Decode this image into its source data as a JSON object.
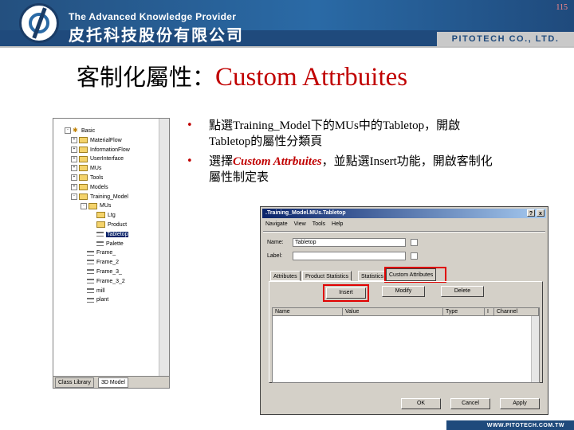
{
  "header": {
    "tagline": "The Advanced Knowledge Provider",
    "company_zh": "皮托科技股份有限公司",
    "company_en": "PITOTECH CO., LTD.",
    "page_number": "115",
    "footer_url": "WWW.PITOTECH.COM.TW"
  },
  "title": {
    "zh": "客制化屬性：",
    "en": "Custom Attrbuites"
  },
  "bullets": [
    {
      "line1_a": "點選",
      "line1_b": "Training_Model",
      "line1_c": "下的",
      "line1_d": "MUs",
      "line1_e": "中的",
      "line1_f": "Tabletop",
      "line1_g": "，開啟",
      "line2_a": "Tabletop",
      "line2_b": "的屬性分類頁"
    },
    {
      "line1_a": "選擇",
      "line1_em": "Custom Attrbuites",
      "line1_b": "，並點選",
      "line1_c": "Insert",
      "line1_d": "功能，開啟客制化",
      "line2": "屬性制定表"
    }
  ],
  "tree": {
    "items": [
      {
        "label": "Basic",
        "icon": "root-icon"
      },
      {
        "label": "MaterialFlow",
        "icon": "folder-icon"
      },
      {
        "label": "InformationFlow",
        "icon": "folder-icon"
      },
      {
        "label": "UserInterface",
        "icon": "folder-icon"
      },
      {
        "label": "MUs",
        "icon": "folder-icon"
      },
      {
        "label": "Tools",
        "icon": "folder-icon"
      },
      {
        "label": "Models",
        "icon": "folder-icon"
      },
      {
        "label": "Training_Model",
        "icon": "folder-icon"
      },
      {
        "label": "MUs",
        "icon": "folder-icon"
      },
      {
        "label": "Ltg",
        "icon": "folder-icon"
      },
      {
        "label": "Product",
        "icon": "folder-icon"
      },
      {
        "label": "Tabletop",
        "icon": "mu-icon"
      },
      {
        "label": "Palette",
        "icon": "mu-icon"
      },
      {
        "label": "Frame_",
        "icon": "frame-icon"
      },
      {
        "label": "Frame_2",
        "icon": "frame-icon"
      },
      {
        "label": "Frame_3_",
        "icon": "frame-icon"
      },
      {
        "label": "Frame_3_2",
        "icon": "frame-icon"
      },
      {
        "label": "mill",
        "icon": "frame-icon"
      },
      {
        "label": "plant",
        "icon": "frame-icon"
      }
    ],
    "tabs": [
      "Class Library",
      "3D Model"
    ]
  },
  "dialog": {
    "title": ".Training_Model.MUs.Tabletop",
    "title_buttons": [
      "?",
      "x"
    ],
    "menu": [
      "Navigate",
      "View",
      "Tools",
      "Help"
    ],
    "name_label": "Name:",
    "name_value": "Tabletop",
    "label_label": "Label:",
    "label_value": "",
    "tabs": [
      "Attributes",
      "Product Statistics",
      "Statistics",
      "Custom Attributes"
    ],
    "insert_label": "Insert",
    "modify_label": "Modify",
    "delete_label": "Delete",
    "columns": [
      "Name",
      "Value",
      "Type",
      "I",
      "Channel"
    ],
    "ok_label": "OK",
    "cancel_label": "Cancel",
    "apply_label": "Apply"
  },
  "colors": {
    "accent_red": "#c00000",
    "banner_blue": "#1f4a7c",
    "highlight_red": "#e00000"
  }
}
